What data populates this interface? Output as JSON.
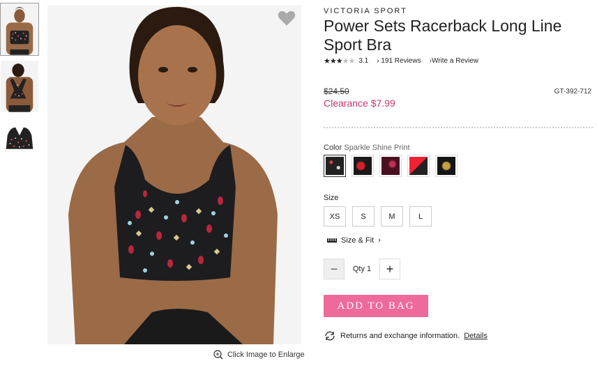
{
  "gallery": {
    "enlarge_label": "Click Image to Enlarge"
  },
  "product": {
    "brand": "VICTORIA SPORT",
    "title": "Power Sets Racerback Long Line Sport Bra",
    "rating_value": "3.1",
    "rating_stars": 3,
    "reviews_label": "191 Reviews",
    "write_review_label": "Write a Review",
    "original_price": "$24.50",
    "sale_price": "Clearance $7.99",
    "sku": "GT-392-712",
    "color_label": "Color",
    "selected_color": "Sparkle Shine Print",
    "size_label": "Size",
    "sizes": [
      "XS",
      "S",
      "M",
      "L"
    ],
    "size_fit_label": "Size & Fit",
    "qty_label": "Qty",
    "qty_value": "1",
    "add_to_bag_label": "ADD TO BAG",
    "returns_text": "Returns and exchange information.",
    "details_label": "Details"
  },
  "colors": {
    "sale": "#c8336f",
    "button": "#ed6a9a"
  }
}
